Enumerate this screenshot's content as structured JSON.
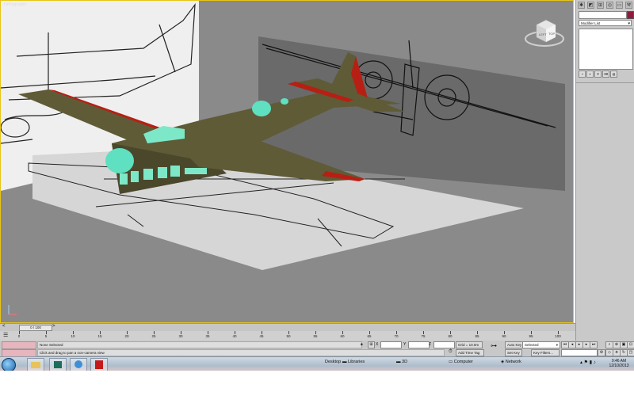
{
  "viewport": {
    "label": "Orthographic",
    "viewcube_faces": {
      "top": "TOP",
      "left": "LEFT"
    }
  },
  "command_panel": {
    "modifier_list": "Modifier List",
    "name_value": "",
    "object_color": "#8e1b3c"
  },
  "time_slider": {
    "position": "0 / 100"
  },
  "track_ticks": [
    "0",
    "5",
    "10",
    "15",
    "20",
    "25",
    "30",
    "35",
    "40",
    "45",
    "50",
    "55",
    "60",
    "65",
    "70",
    "75",
    "80",
    "85",
    "90",
    "95",
    "100"
  ],
  "status": {
    "selection": "None Selected",
    "prompt": "Click and drag to pan a non-camera view",
    "x_label": "X",
    "y_label": "Y",
    "z_label": "Z",
    "grid": "Grid = 10.0m",
    "add_time_tag": "Add Time Tag",
    "auto_key": "Auto Key",
    "auto_key_mode": "Selected",
    "set_key": "Set Key",
    "key_filters": "Key Filters..."
  },
  "taskbar": {
    "desktop": "Desktop",
    "libraries": "Libraries",
    "folder": "3D",
    "computer": "Computer",
    "network": "Network",
    "time": "9:46 AM",
    "date": "12/10/2013"
  },
  "colors": {
    "viewport_bg": "#8a8a8a",
    "fuselage": "#5f5b37",
    "glass": "#5fe0c0",
    "wing_accent": "#b71f14",
    "viewport_border": "#e8c417"
  }
}
